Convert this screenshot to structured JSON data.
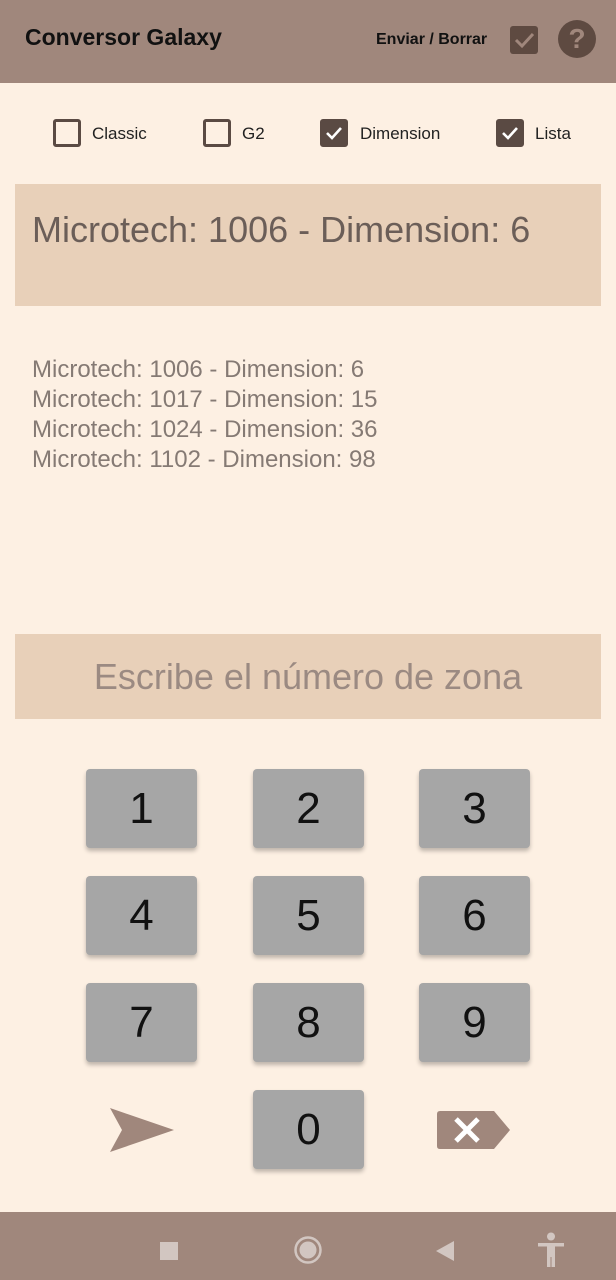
{
  "appbar": {
    "title": "Conversor Galaxy",
    "send_clear_label": "Enviar / Borrar",
    "check_icon": "checkbox-checked-icon",
    "help_icon": "help-icon",
    "help_glyph": "?"
  },
  "options": [
    {
      "label": "Classic",
      "checked": false
    },
    {
      "label": "G2",
      "checked": false
    },
    {
      "label": "Dimension",
      "checked": true
    },
    {
      "label": "Lista",
      "checked": true
    }
  ],
  "result": {
    "text": "Microtech: 1006 - Dimension: 6"
  },
  "history": [
    "Microtech: 1006 - Dimension: 6",
    "Microtech: 1017 - Dimension: 15",
    "Microtech: 1024 - Dimension: 36",
    "Microtech: 1102 - Dimension: 98"
  ],
  "zone_input": {
    "value": "",
    "placeholder": "Escribe el número de zona"
  },
  "keypad": {
    "keys": [
      "1",
      "2",
      "3",
      "4",
      "5",
      "6",
      "7",
      "8",
      "9",
      "0"
    ],
    "send_icon": "send-icon",
    "delete_icon": "backspace-icon"
  },
  "navbar": {
    "icons": [
      "recents-icon",
      "home-icon",
      "back-icon",
      "accessibility-icon"
    ]
  },
  "colors": {
    "appbar": "#a0877c",
    "background": "#fdf0e3",
    "panel": "#e8d0b9",
    "key": "#a6a6a6",
    "dark_accent": "#5e4a41"
  }
}
